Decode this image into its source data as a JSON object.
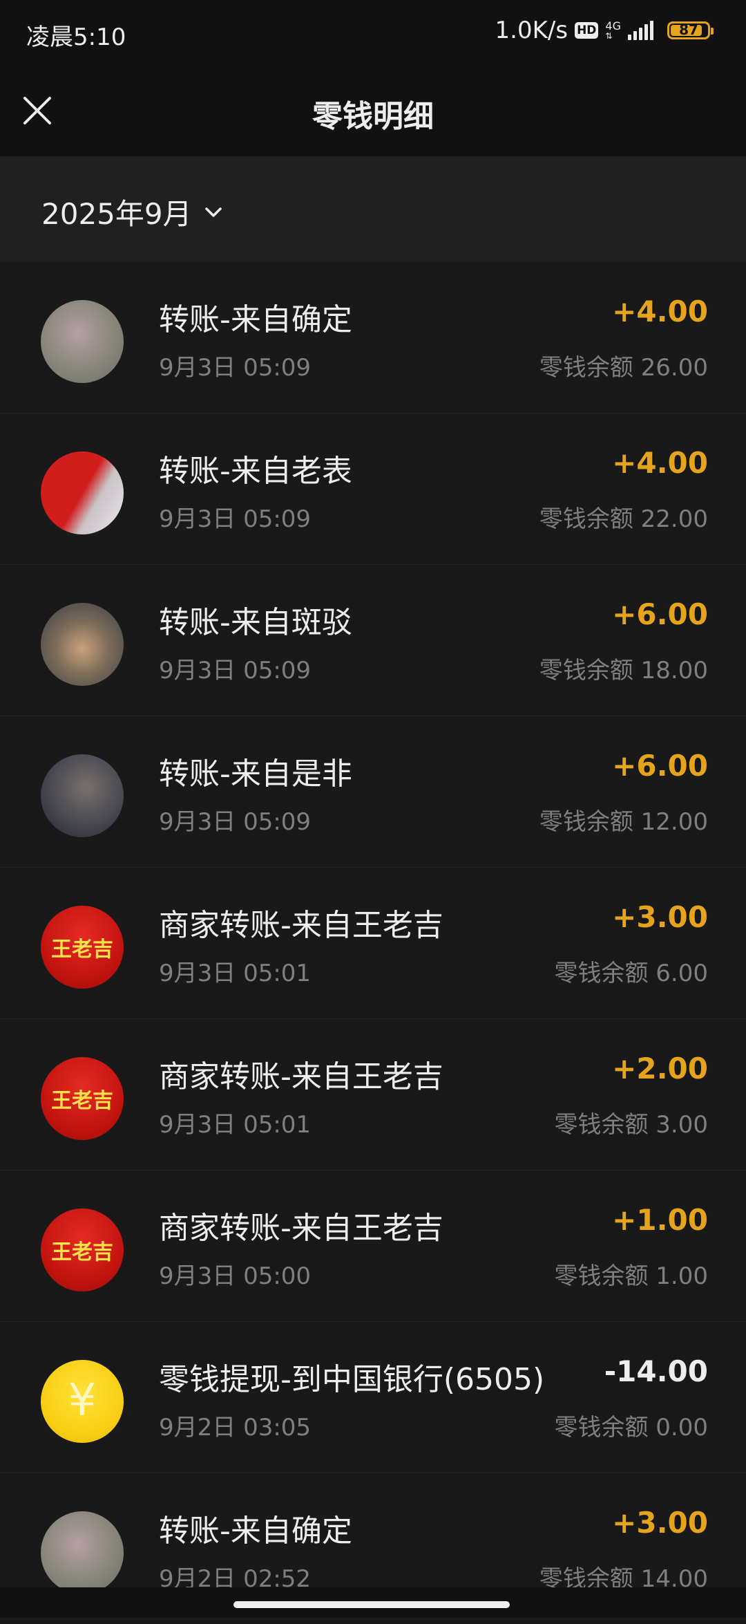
{
  "status_bar": {
    "time": "凌晨5:10",
    "speed": "1.0K/s",
    "hd": "HD",
    "network": "4G",
    "battery": "87",
    "battery_level": 0.87,
    "battery_color": "#e6a41c"
  },
  "header": {
    "title": "零钱明细",
    "close_icon": "close-icon"
  },
  "month_filter": {
    "label": "2025年9月",
    "icon": "chevron-down-icon"
  },
  "transactions": [
    {
      "title": "转账-来自确定",
      "date": "9月3日 05:09",
      "amount": "+4.00",
      "balance": "零钱余额 26.00",
      "avatar": "photo-pink"
    },
    {
      "title": "转账-来自老表",
      "date": "9月3日 05:09",
      "amount": "+4.00",
      "balance": "零钱余额 22.00",
      "avatar": "photo-flag"
    },
    {
      "title": "转账-来自斑驳",
      "date": "9月3日 05:09",
      "amount": "+6.00",
      "balance": "零钱余额 18.00",
      "avatar": "photo-crowd"
    },
    {
      "title": "转账-来自是非",
      "date": "9月3日 05:09",
      "amount": "+6.00",
      "balance": "零钱余额 12.00",
      "avatar": "photo-hat"
    },
    {
      "title": "商家转账-来自王老吉",
      "date": "9月3日 05:01",
      "amount": "+3.00",
      "balance": "零钱余额 6.00",
      "avatar": "logo",
      "avatar_text": "王老吉"
    },
    {
      "title": "商家转账-来自王老吉",
      "date": "9月3日 05:01",
      "amount": "+2.00",
      "balance": "零钱余额 3.00",
      "avatar": "logo",
      "avatar_text": "王老吉"
    },
    {
      "title": "商家转账-来自王老吉",
      "date": "9月3日 05:00",
      "amount": "+1.00",
      "balance": "零钱余额 1.00",
      "avatar": "logo",
      "avatar_text": "王老吉"
    },
    {
      "title": "零钱提现-到中国银行(6505)",
      "date": "9月2日 03:05",
      "amount": "-14.00",
      "balance": "零钱余额 0.00",
      "avatar": "yuan-icon",
      "avatar_text": "¥"
    },
    {
      "title": "转账-来自确定",
      "date": "9月2日 02:52",
      "amount": "+3.00",
      "balance": "零钱余额 14.00",
      "avatar": "photo-pink"
    }
  ],
  "colors": {
    "income": "#e6a41c",
    "expense": "#ededed",
    "background": "#191919"
  }
}
